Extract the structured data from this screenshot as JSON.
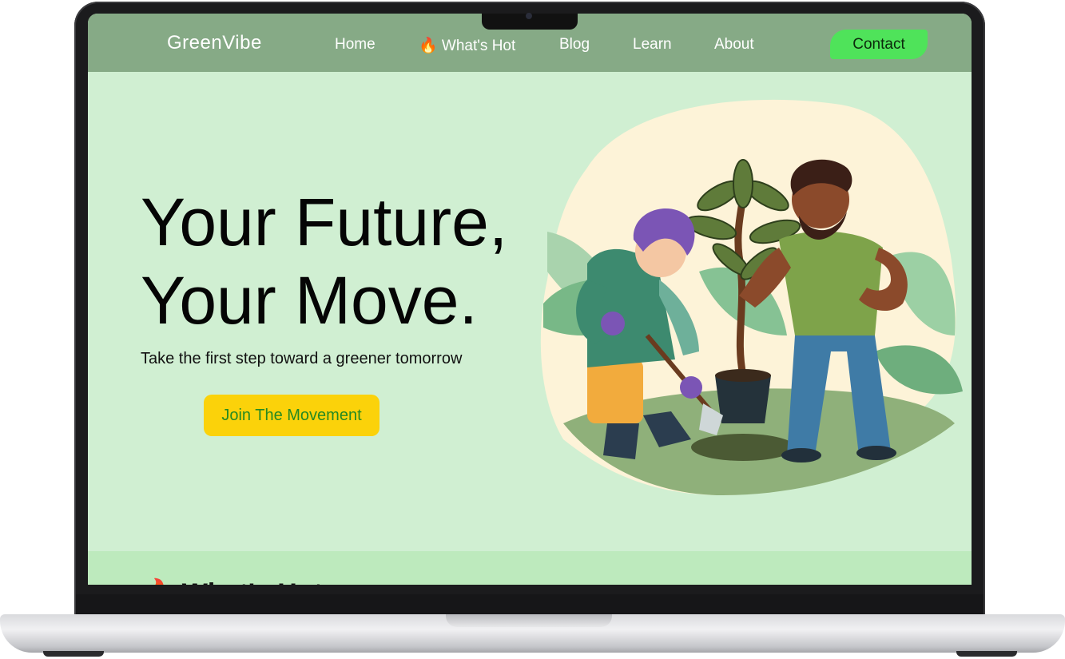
{
  "navbar": {
    "brand": "GreenVibe",
    "links": [
      {
        "label": "Home"
      },
      {
        "label": "🔥 What's Hot"
      },
      {
        "label": "Blog"
      },
      {
        "label": "Learn"
      },
      {
        "label": "About"
      }
    ],
    "contact_label": "Contact"
  },
  "hero": {
    "title_line1": "Your Future,",
    "title_line2": "Your Move.",
    "subtitle": "Take the first step toward a greener tomorrow",
    "cta_label": "Join The Movement"
  },
  "next_section": {
    "heading": "🔥 What's Hot"
  },
  "colors": {
    "navbar": "#86aa86",
    "page_background": "#d0efd2",
    "contact_button": "#4fe35a",
    "cta_button": "#fbd20a",
    "cta_text": "#258a22",
    "section_strip": "#bdeabd"
  }
}
